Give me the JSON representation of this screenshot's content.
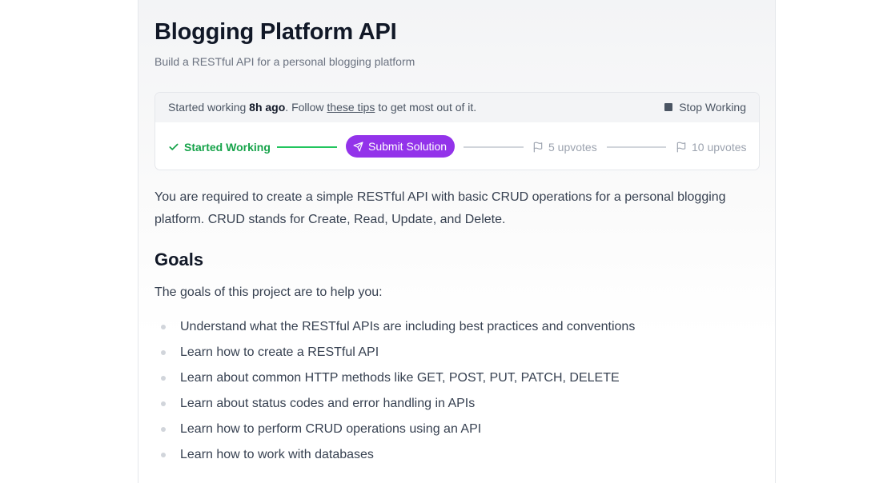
{
  "header": {
    "title": "Blogging Platform API",
    "subtitle": "Build a RESTful API for a personal blogging platform"
  },
  "status": {
    "prefix": "Started working",
    "elapsed": "8h ago",
    "mid": ". Follow",
    "tips_link": "these tips",
    "suffix": "to get most out of it.",
    "stop_label": "Stop Working"
  },
  "steps": {
    "started_label": "Started Working",
    "submit_label": "Submit Solution",
    "upvotes_5_label": "5 upvotes",
    "upvotes_10_label": "10 upvotes"
  },
  "content": {
    "description": "You are required to create a simple RESTful API with basic CRUD operations for a personal blogging platform. CRUD stands for Create, Read, Update, and Delete.",
    "goals_title": "Goals",
    "goals_intro": "The goals of this project are to help you:",
    "goals": [
      "Understand what the RESTful APIs are including best practices and conventions",
      "Learn how to create a RESTful API",
      "Learn about common HTTP methods like GET, POST, PUT, PATCH, DELETE",
      "Learn about status codes and error handling in APIs",
      "Learn how to perform CRUD operations using an API",
      "Learn how to work with databases"
    ]
  },
  "icons": {
    "check": "check-icon",
    "send": "send-icon",
    "flag": "flag-icon",
    "stop": "stop-square-icon"
  },
  "colors": {
    "accent_purple": "#9333ea",
    "success_green": "#16a34a",
    "muted_gray": "#9ca3af"
  }
}
